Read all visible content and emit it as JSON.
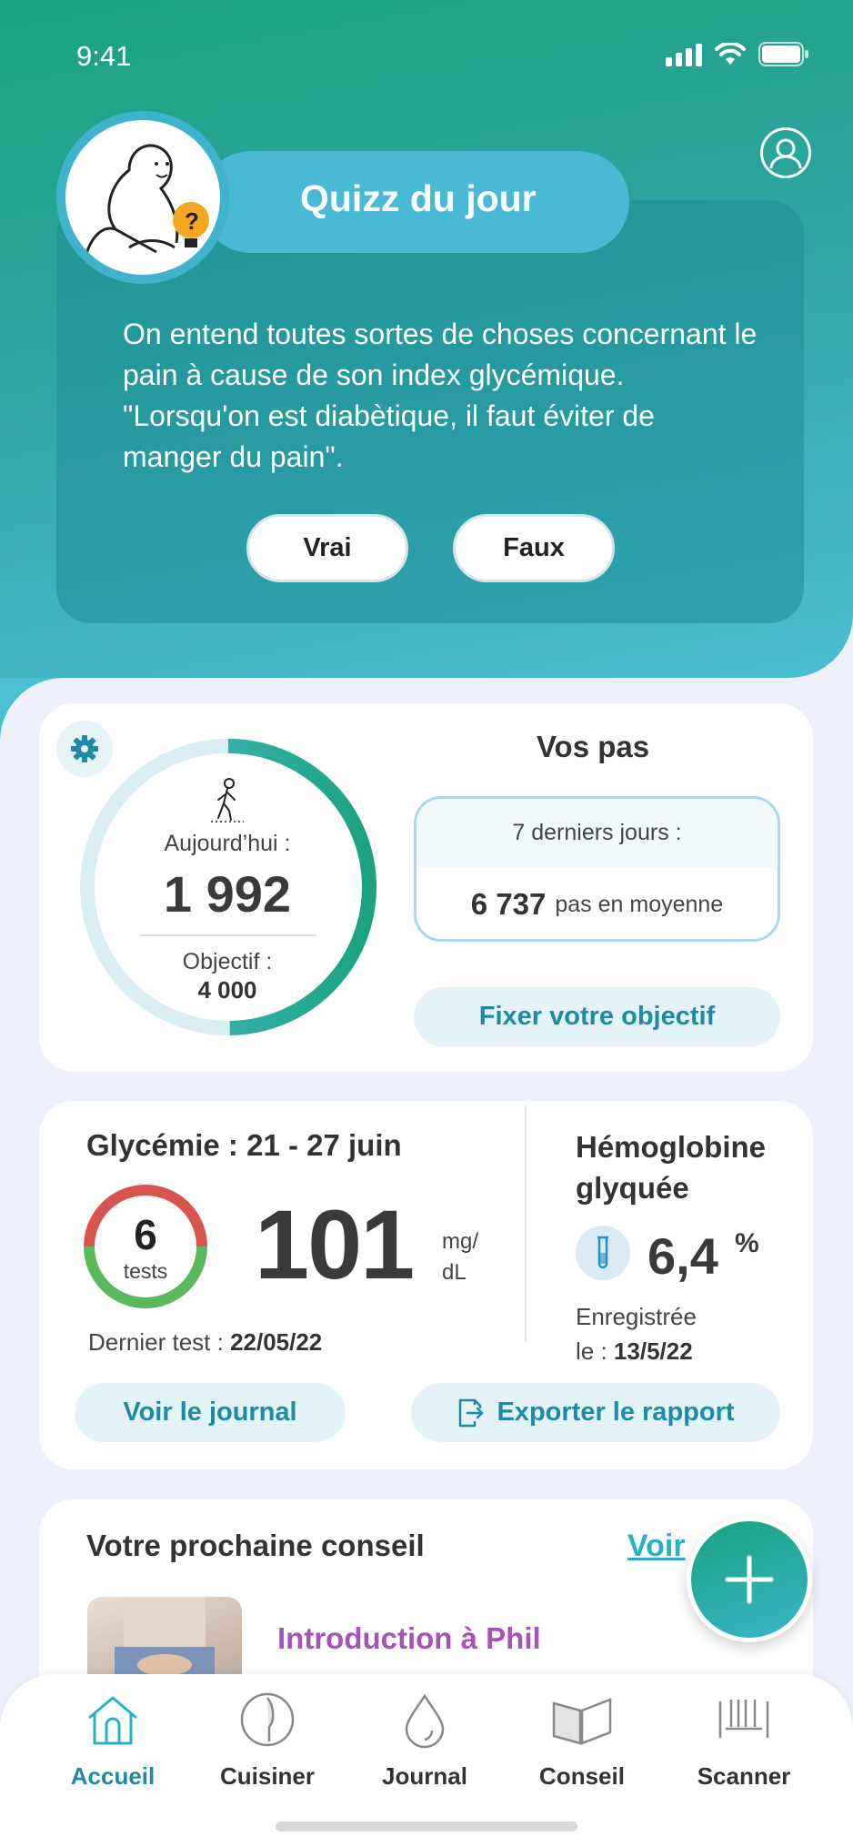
{
  "status_bar": {
    "time": "9:41"
  },
  "quiz": {
    "title": "Quizz du jour",
    "question": "On entend toutes sortes de choses concernant le pain à cause de son index glycémique. \"Lorsqu'on est diabètique, il faut éviter de manger du pain\".",
    "true_label": "Vrai",
    "false_label": "Faux"
  },
  "steps": {
    "today_label": "Aujourd’hui :",
    "today_value": "1 992",
    "goal_label": "Objectif :",
    "goal_value": "4 000",
    "progress": 0.498,
    "title": "Vos pas",
    "period_label": "7 derniers jours :",
    "average_value": "6 737",
    "average_unit": "pas en moyenne",
    "set_goal_label": "Fixer votre objectif"
  },
  "glycemia": {
    "title": "Glycémie : 21 - 27 juin",
    "tests_count": "6",
    "tests_label": "tests",
    "value": "101",
    "unit_line1": "mg/",
    "unit_line2": "dL",
    "last_test_label": "Dernier test :",
    "last_test_date": "22/05/22",
    "journal_button": "Voir le journal",
    "export_button": "Exporter le rapport",
    "ring_colors": {
      "red": "#d9534f",
      "green": "#5cb85c"
    }
  },
  "hba1c": {
    "title_line1": "Hémoglobine",
    "title_line2": "glyquée",
    "value": "6,4",
    "unit": "%",
    "recorded_line1": "Enregistrée",
    "recorded_label": "le :",
    "recorded_date": "13/5/22"
  },
  "advice": {
    "title": "Votre prochaine conseil",
    "see_link": "Voir",
    "item_title": "Introduction à Phil"
  },
  "tabs": [
    {
      "label": "Accueil",
      "icon": "home-icon"
    },
    {
      "label": "Cuisiner",
      "icon": "plate-knife-icon"
    },
    {
      "label": "Journal",
      "icon": "drop-icon"
    },
    {
      "label": "Conseil",
      "icon": "book-icon"
    },
    {
      "label": "Scanner",
      "icon": "barcode-icon"
    }
  ],
  "colors": {
    "accent": "#1e8aa5",
    "brand_green": "#1ba27f",
    "brand_cyan": "#4bbfd3",
    "advice_purple": "#a653b8"
  }
}
